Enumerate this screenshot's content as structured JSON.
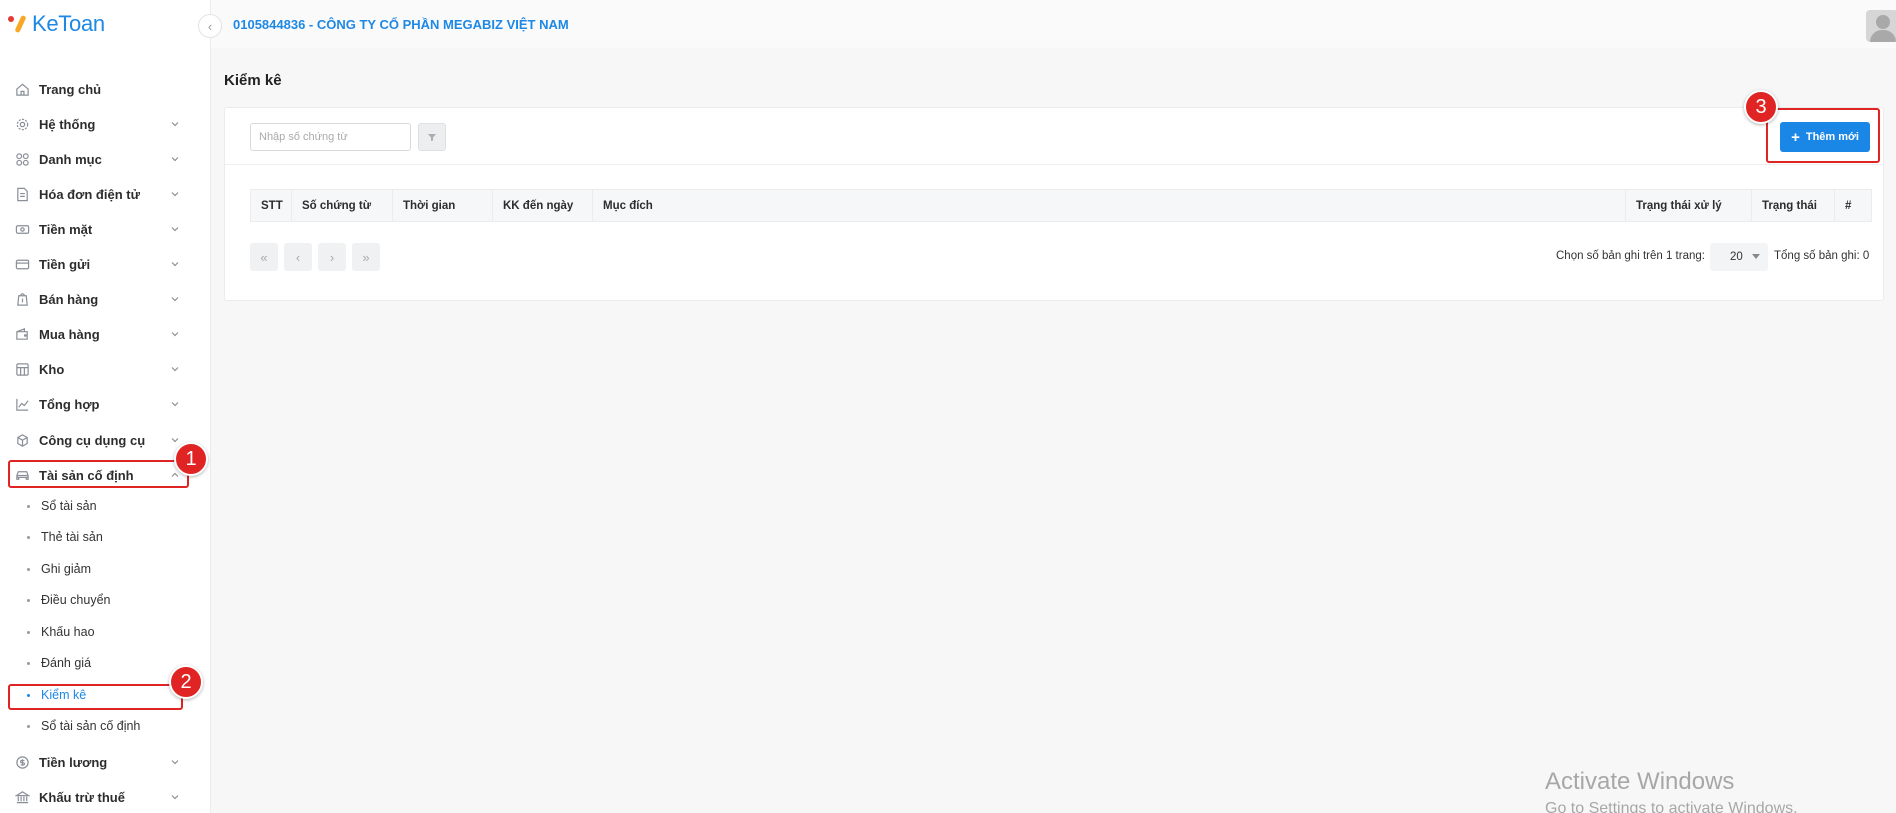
{
  "app": {
    "logo_text": "KeToan"
  },
  "header": {
    "company": "0105844836 - CÔNG TY CỔ PHẦN MEGABIZ VIỆT NAM"
  },
  "sidebar": {
    "items": [
      {
        "label": "Trang chủ",
        "icon": "home-icon"
      },
      {
        "label": "Hệ thống",
        "icon": "gear-icon"
      },
      {
        "label": "Danh mục",
        "icon": "grid-icon"
      },
      {
        "label": "Hóa đơn điện tử",
        "icon": "invoice-icon"
      },
      {
        "label": "Tiền mặt",
        "icon": "cash-icon"
      },
      {
        "label": "Tiền gửi",
        "icon": "card-icon"
      },
      {
        "label": "Bán hàng",
        "icon": "bag-icon"
      },
      {
        "label": "Mua hàng",
        "icon": "wallet-icon"
      },
      {
        "label": "Kho",
        "icon": "warehouse-icon"
      },
      {
        "label": "Tổng hợp",
        "icon": "chart-line-icon"
      },
      {
        "label": "Công cụ dụng cụ",
        "icon": "tools-icon"
      },
      {
        "label": "Tài sản cố định",
        "icon": "car-icon"
      },
      {
        "label": "Tiền lương",
        "icon": "dollar-icon"
      },
      {
        "label": "Khấu trừ thuế",
        "icon": "bank-icon"
      }
    ],
    "sub_items": [
      "Sổ tài sản",
      "Thẻ tài sản",
      "Ghi giảm",
      "Điều chuyển",
      "Khấu hao",
      "Đánh giá",
      "Kiểm kê",
      "Sổ tài sản cố định"
    ]
  },
  "page": {
    "title": "Kiểm kê",
    "search_placeholder": "Nhập số chứng từ",
    "add_button": "Thêm mới",
    "columns": [
      "STT",
      "Số chứng từ",
      "Thời gian",
      "KK đến ngày",
      "Mục đích",
      "Trạng thái xử lý",
      "Trạng thái",
      "#"
    ],
    "pager": {
      "first": "«",
      "prev": "‹",
      "next": "›",
      "last": "»",
      "page_size_label": "Chọn số bản ghi trên 1 trang:",
      "page_size": "20",
      "total_label": "Tổng số bản ghi: 0"
    }
  },
  "annotations": {
    "badge_1": "1",
    "badge_2": "2",
    "badge_3": "3"
  },
  "watermark": {
    "line1": "Activate Windows",
    "line2": "Go to Settings to activate Windows."
  },
  "colors": {
    "accent": "#1e88e5",
    "annotation": "#e02424"
  }
}
